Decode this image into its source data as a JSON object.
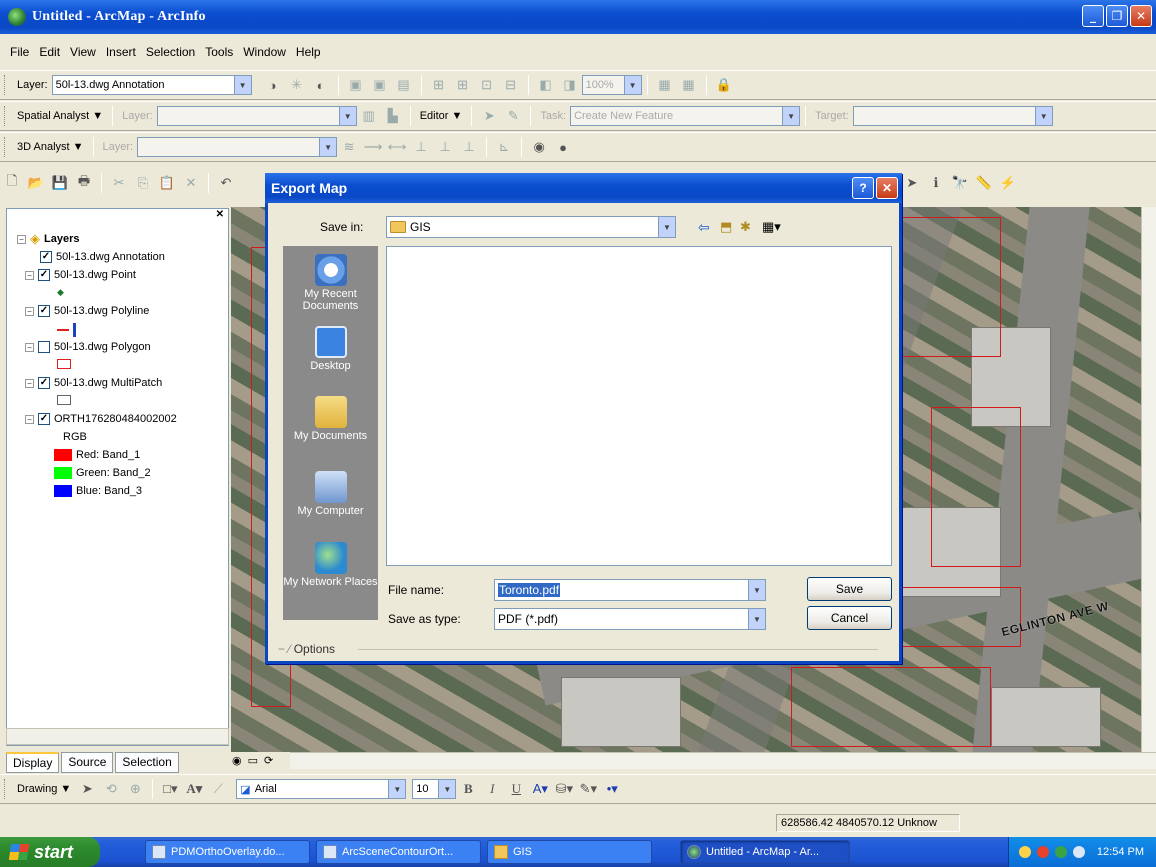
{
  "window": {
    "title": "Untitled - ArcMap - ArcInfo"
  },
  "menu": [
    "File",
    "Edit",
    "View",
    "Insert",
    "Selection",
    "Tools",
    "Window",
    "Help"
  ],
  "toolbar_layer": {
    "label": "Layer:",
    "value": "50l-13.dwg Annotation",
    "zoom": "100%"
  },
  "toolbar_spatial": {
    "spatial_analyst": "Spatial Analyst ▼",
    "layer_label": "Layer:",
    "editor": "Editor ▼",
    "task_label": "Task:",
    "task_value": "Create New Feature",
    "target_label": "Target:"
  },
  "toolbar_3d": {
    "analyst": "3D Analyst ▼",
    "layer_label": "Layer:"
  },
  "toc": {
    "root": "Layers",
    "layers": [
      {
        "name": "50l-13.dwg Annotation",
        "checked": true
      },
      {
        "name": "50l-13.dwg Point",
        "checked": true
      },
      {
        "name": "50l-13.dwg Polyline",
        "checked": true
      },
      {
        "name": "50l-13.dwg Polygon",
        "checked": false
      },
      {
        "name": "50l-13.dwg MultiPatch",
        "checked": true
      },
      {
        "name": "ORTH176280484002002",
        "checked": true
      }
    ],
    "rgb_label": "RGB",
    "bands": [
      {
        "label": "Red:  Band_1",
        "color": "#ff0000"
      },
      {
        "label": "Green: Band_2",
        "color": "#00ff00"
      },
      {
        "label": "Blue:  Band_3",
        "color": "#0000ff"
      }
    ],
    "tabs": [
      "Display",
      "Source",
      "Selection"
    ]
  },
  "dialog": {
    "title": "Export Map",
    "save_in_label": "Save in:",
    "save_in_value": "GIS",
    "places": [
      "My Recent Documents",
      "Desktop",
      "My Documents",
      "My Computer",
      "My Network Places"
    ],
    "file_name_label": "File name:",
    "file_name_value": "Toronto.pdf",
    "save_as_type_label": "Save as type:",
    "save_as_type_value": "PDF (*.pdf)",
    "save_button": "Save",
    "cancel_button": "Cancel",
    "options": "Options"
  },
  "map": {
    "street_label": "EGLINTON AVE W"
  },
  "drawing_toolbar": {
    "drawing": "Drawing ▼",
    "font": "Arial",
    "size": "10"
  },
  "status": {
    "coords": "628586.42  4840570.12 Unknow"
  },
  "taskbar": {
    "start": "start",
    "tasks": [
      "PDMOrthoOverlay.do...",
      "ArcSceneContourOrt...",
      "GIS",
      "Untitled - ArcMap - Ar..."
    ],
    "clock": "12:54 PM"
  }
}
